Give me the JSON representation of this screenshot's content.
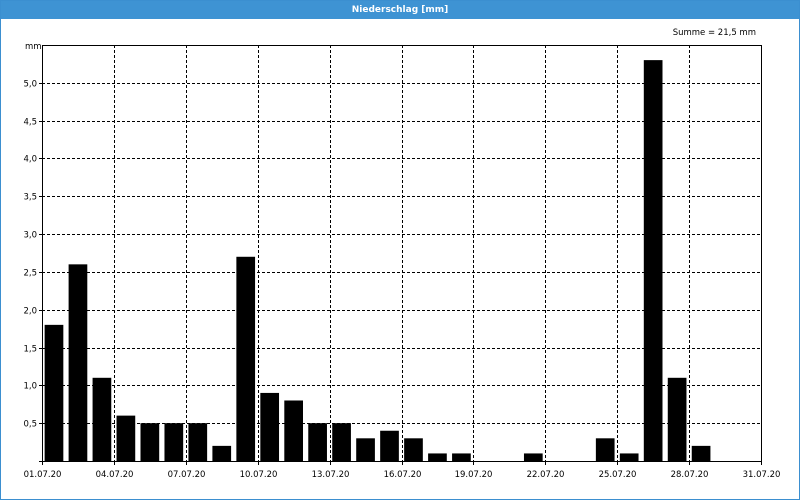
{
  "window": {
    "title": "Niederschlag [mm]"
  },
  "chart_data": {
    "type": "bar",
    "title": "Niederschlag [mm]",
    "ylabel": "mm",
    "annotation": "Summe = 21,5 mm",
    "ylim": [
      0,
      5.5
    ],
    "yticks": [
      {
        "value": 0.5,
        "label": "0,5"
      },
      {
        "value": 1.0,
        "label": "1,0"
      },
      {
        "value": 1.5,
        "label": "1,5"
      },
      {
        "value": 2.0,
        "label": "2,0"
      },
      {
        "value": 2.5,
        "label": "2,5"
      },
      {
        "value": 3.0,
        "label": "3,0"
      },
      {
        "value": 3.5,
        "label": "3,5"
      },
      {
        "value": 4.0,
        "label": "4,0"
      },
      {
        "value": 4.5,
        "label": "4,5"
      },
      {
        "value": 5.0,
        "label": "5,0"
      }
    ],
    "xticks": [
      {
        "day": 1,
        "label": "01.07.20"
      },
      {
        "day": 4,
        "label": "04.07.20"
      },
      {
        "day": 7,
        "label": "07.07.20"
      },
      {
        "day": 10,
        "label": "10.07.20"
      },
      {
        "day": 13,
        "label": "13.07.20"
      },
      {
        "day": 16,
        "label": "16.07.20"
      },
      {
        "day": 19,
        "label": "19.07.20"
      },
      {
        "day": 22,
        "label": "22.07.20"
      },
      {
        "day": 25,
        "label": "25.07.20"
      },
      {
        "day": 28,
        "label": "28.07.20"
      },
      {
        "day": 31,
        "label": "31.07.20"
      }
    ],
    "grid": true,
    "bar_color": "#000000",
    "x": [
      1,
      2,
      3,
      4,
      5,
      6,
      7,
      8,
      9,
      10,
      11,
      12,
      13,
      14,
      15,
      16,
      17,
      18,
      19,
      20,
      21,
      22,
      23,
      24,
      25,
      26,
      27,
      28,
      29,
      30
    ],
    "values": [
      1.8,
      2.6,
      1.1,
      0.6,
      0.5,
      0.5,
      0.5,
      0.2,
      2.7,
      0.9,
      0.8,
      0.5,
      0.5,
      0.3,
      0.4,
      0.3,
      0.1,
      0.1,
      0,
      0,
      0.1,
      0,
      0,
      0.3,
      0.1,
      5.3,
      1.1,
      0.2,
      0,
      0
    ]
  }
}
